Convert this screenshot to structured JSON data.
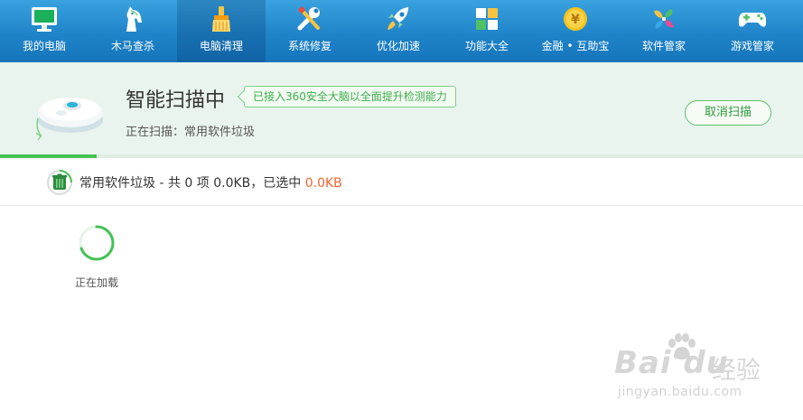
{
  "nav": {
    "items": [
      {
        "label": "我的电脑",
        "icon": "monitor-icon",
        "active": false
      },
      {
        "label": "木马查杀",
        "icon": "horse-icon",
        "active": false
      },
      {
        "label": "电脑清理",
        "icon": "broom-icon",
        "active": true
      },
      {
        "label": "系统修复",
        "icon": "wrench-icon",
        "active": false
      },
      {
        "label": "优化加速",
        "icon": "rocket-icon",
        "active": false
      },
      {
        "label": "功能大全",
        "icon": "grid-icon",
        "active": false
      },
      {
        "label": "金融 • 互助宝",
        "icon": "coin-icon",
        "active": false
      },
      {
        "label": "软件管家",
        "icon": "windmill-icon",
        "active": false
      },
      {
        "label": "游戏管家",
        "icon": "gamepad-icon",
        "active": false
      }
    ]
  },
  "scan": {
    "title": "智能扫描中",
    "tip": "已接入360安全大脑以全面提升检测能力",
    "status": "正在扫描：常用软件垃圾",
    "cancel_label": "取消扫描",
    "progress_percent": 12
  },
  "category": {
    "prefix": "常用软件垃圾 - 共 0 项 0.0KB，已选中 ",
    "selected_size": "0.0KB"
  },
  "loading": {
    "text": "正在加载"
  },
  "watermark": {
    "logo": "Bai  du",
    "cn": "经验",
    "url": "jingyan.baidu.com"
  },
  "colors": {
    "nav_bg": "#1f84c9",
    "accent_green": "#43c255",
    "selected_orange": "#f0652b",
    "header_bg": "#eaf4ee"
  }
}
